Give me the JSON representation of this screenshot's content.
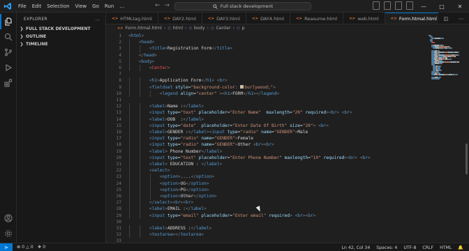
{
  "titlebar": {
    "menu": [
      "File",
      "Edit",
      "Selection",
      "View",
      "Go",
      "Run",
      "…"
    ],
    "search_text": "Full stack development",
    "window_controls": [
      "minimize",
      "maximize",
      "close"
    ]
  },
  "sidebar": {
    "header": "EXPLORER",
    "more": "…",
    "sections": [
      "FULL STACK DEVELOPMENT",
      "OUTLINE",
      "TIMELINE"
    ]
  },
  "tabs": [
    {
      "label": "HTMLtag.html",
      "active": false
    },
    {
      "label": "DAY2.html",
      "active": false
    },
    {
      "label": "DAY3.html",
      "active": false
    },
    {
      "label": "DAY4.html",
      "active": false
    },
    {
      "label": "Reasume.html",
      "active": false
    },
    {
      "label": "web.html",
      "active": false
    },
    {
      "label": "Form.htmal.html",
      "active": true
    },
    {
      "label": "demo.ht",
      "active": false
    }
  ],
  "tab_close": "×",
  "breadcrumb": [
    "Form.htmal.html",
    "html",
    "body",
    "Center",
    "p"
  ],
  "status": {
    "errors": "0",
    "warnings": "0",
    "ports": "0",
    "position": "Ln 42, Col 34",
    "spaces": "Spaces: 4",
    "encoding": "UTF-8",
    "eol": "CRLF",
    "language": "HTML"
  },
  "colors": {
    "accent": "#0078d4",
    "tag": "#569cd6",
    "attr": "#9cdcfe",
    "string": "#ce9178",
    "center_tag": "#f14c4c",
    "swatch": "#deb887"
  },
  "code_lines": [
    {
      "n": "1",
      "indent": 0,
      "tokens": [
        [
          "p",
          "<"
        ],
        [
          "t",
          "html"
        ],
        [
          "p",
          ">"
        ]
      ]
    },
    {
      "n": "2",
      "indent": 1,
      "tokens": [
        [
          "p",
          "<"
        ],
        [
          "t",
          "head"
        ],
        [
          "p",
          ">"
        ]
      ]
    },
    {
      "n": "3",
      "indent": 2,
      "tokens": [
        [
          "p",
          "<"
        ],
        [
          "t",
          "title"
        ],
        [
          "p",
          ">"
        ],
        [
          "tx",
          "Registration Form"
        ],
        [
          "p",
          "</"
        ],
        [
          "t",
          "title"
        ],
        [
          "p",
          ">"
        ]
      ]
    },
    {
      "n": "4",
      "indent": 1,
      "tokens": [
        [
          "p",
          "</"
        ],
        [
          "t",
          "head"
        ],
        [
          "p",
          ">"
        ]
      ]
    },
    {
      "n": "5",
      "indent": 1,
      "tokens": [
        [
          "p",
          "<"
        ],
        [
          "t",
          "body"
        ],
        [
          "p",
          ">"
        ]
      ]
    },
    {
      "n": "6",
      "indent": 2,
      "tokens": [
        [
          "p",
          "<"
        ],
        [
          "ctr",
          "Center"
        ],
        [
          "p",
          ">"
        ]
      ]
    },
    {
      "n": "7",
      "indent": 0,
      "tokens": []
    },
    {
      "n": "8",
      "indent": 2,
      "tokens": [
        [
          "p",
          "<"
        ],
        [
          "t",
          "h1"
        ],
        [
          "p",
          ">"
        ],
        [
          "tx",
          "Application Form"
        ],
        [
          "p",
          "</"
        ],
        [
          "t",
          "h1"
        ],
        [
          "p",
          ">"
        ],
        [
          "tx",
          " "
        ],
        [
          "p",
          "<"
        ],
        [
          "t",
          "br"
        ],
        [
          "p",
          ">"
        ]
      ]
    },
    {
      "n": "9",
      "indent": 2,
      "tokens": [
        [
          "p",
          "<"
        ],
        [
          "t",
          "fieldset"
        ],
        [
          "tx",
          " "
        ],
        [
          "a",
          "style"
        ],
        [
          "tx",
          "="
        ],
        [
          "s",
          "\"background-color: "
        ],
        [
          "sw",
          ""
        ],
        [
          "s",
          "burlywood;\""
        ],
        [
          "p",
          ">"
        ]
      ]
    },
    {
      "n": "10",
      "indent": 3,
      "tokens": [
        [
          "p",
          "<"
        ],
        [
          "t",
          "legend"
        ],
        [
          "tx",
          " "
        ],
        [
          "a",
          "align"
        ],
        [
          "tx",
          "="
        ],
        [
          "s",
          "\"center\""
        ],
        [
          "tx",
          " "
        ],
        [
          "p",
          ">"
        ],
        [
          "p",
          "<"
        ],
        [
          "t",
          "h1"
        ],
        [
          "p",
          ">"
        ],
        [
          "tx",
          "FORM"
        ],
        [
          "p",
          "</"
        ],
        [
          "t",
          "h1"
        ],
        [
          "p",
          ">"
        ],
        [
          "p",
          "</"
        ],
        [
          "t",
          "legend"
        ],
        [
          "p",
          ">"
        ]
      ]
    },
    {
      "n": "11",
      "indent": 0,
      "tokens": []
    },
    {
      "n": "12",
      "indent": 2,
      "tokens": [
        [
          "p",
          "<"
        ],
        [
          "t",
          "label"
        ],
        [
          "p",
          ">"
        ],
        [
          "tx",
          "Name :"
        ],
        [
          "p",
          "</"
        ],
        [
          "t",
          "label"
        ],
        [
          "p",
          ">"
        ]
      ]
    },
    {
      "n": "13",
      "indent": 2,
      "tokens": [
        [
          "p",
          "<"
        ],
        [
          "t",
          "input"
        ],
        [
          "tx",
          " "
        ],
        [
          "a",
          "type"
        ],
        [
          "tx",
          "="
        ],
        [
          "s",
          "\"text\""
        ],
        [
          "tx",
          " "
        ],
        [
          "a",
          "placeholder"
        ],
        [
          "tx",
          "="
        ],
        [
          "s",
          "\"Enter Name\""
        ],
        [
          "tx",
          "  "
        ],
        [
          "a",
          "maxlength"
        ],
        [
          "tx",
          "="
        ],
        [
          "s",
          "\"20\""
        ],
        [
          "tx",
          " "
        ],
        [
          "a",
          "required"
        ],
        [
          "p",
          ">"
        ],
        [
          "p",
          "<"
        ],
        [
          "t",
          "br"
        ],
        [
          "p",
          ">"
        ],
        [
          "tx",
          " "
        ],
        [
          "p",
          "<"
        ],
        [
          "t",
          "br"
        ],
        [
          "p",
          ">"
        ]
      ]
    },
    {
      "n": "14",
      "indent": 2,
      "tokens": [
        [
          "p",
          "<"
        ],
        [
          "t",
          "label"
        ],
        [
          "p",
          ">"
        ],
        [
          "tx",
          "DOB  :"
        ],
        [
          "p",
          "</"
        ],
        [
          "t",
          "label"
        ],
        [
          "p",
          ">"
        ]
      ]
    },
    {
      "n": "15",
      "indent": 2,
      "tokens": [
        [
          "p",
          "<"
        ],
        [
          "t",
          "input"
        ],
        [
          "tx",
          " "
        ],
        [
          "a",
          "type"
        ],
        [
          "tx",
          "="
        ],
        [
          "s",
          "\"date\""
        ],
        [
          "tx",
          "  "
        ],
        [
          "a",
          "placeholder"
        ],
        [
          "tx",
          "="
        ],
        [
          "s",
          "\"Enter Date Of Birth\""
        ],
        [
          "tx",
          " "
        ],
        [
          "a",
          "size"
        ],
        [
          "tx",
          "="
        ],
        [
          "s",
          "\"20\""
        ],
        [
          "p",
          ">"
        ],
        [
          "tx",
          " "
        ],
        [
          "p",
          "<"
        ],
        [
          "t",
          "br"
        ],
        [
          "p",
          ">"
        ]
      ]
    },
    {
      "n": "16",
      "indent": 2,
      "tokens": [
        [
          "p",
          "<"
        ],
        [
          "t",
          "label"
        ],
        [
          "p",
          ">"
        ],
        [
          "tx",
          "GENDER :"
        ],
        [
          "p",
          "</"
        ],
        [
          "t",
          "label"
        ],
        [
          "p",
          ">"
        ],
        [
          "p",
          "<"
        ],
        [
          "t",
          "input"
        ],
        [
          "tx",
          " "
        ],
        [
          "a",
          "type"
        ],
        [
          "tx",
          "="
        ],
        [
          "s",
          "\"radio\""
        ],
        [
          "tx",
          " "
        ],
        [
          "a",
          "name"
        ],
        [
          "tx",
          "="
        ],
        [
          "s",
          "\"GENDER\""
        ],
        [
          "p",
          ">"
        ],
        [
          "tx",
          "Male"
        ]
      ]
    },
    {
      "n": "17",
      "indent": 2,
      "tokens": [
        [
          "p",
          "<"
        ],
        [
          "t",
          "input"
        ],
        [
          "tx",
          " "
        ],
        [
          "a",
          "type"
        ],
        [
          "tx",
          "="
        ],
        [
          "s",
          "\"radio\""
        ],
        [
          "tx",
          " "
        ],
        [
          "a",
          "name"
        ],
        [
          "tx",
          "="
        ],
        [
          "s",
          "\"GENDER\""
        ],
        [
          "p",
          ">"
        ],
        [
          "tx",
          "Female"
        ]
      ]
    },
    {
      "n": "18",
      "indent": 2,
      "tokens": [
        [
          "p",
          "<"
        ],
        [
          "t",
          "input"
        ],
        [
          "tx",
          " "
        ],
        [
          "a",
          "type"
        ],
        [
          "tx",
          "="
        ],
        [
          "s",
          "\"radio\""
        ],
        [
          "tx",
          " "
        ],
        [
          "a",
          "name"
        ],
        [
          "tx",
          "="
        ],
        [
          "s",
          "\"GENDER\""
        ],
        [
          "p",
          ">"
        ],
        [
          "tx",
          "Other "
        ],
        [
          "p",
          "<"
        ],
        [
          "t",
          "br"
        ],
        [
          "p",
          ">"
        ],
        [
          "p",
          "<"
        ],
        [
          "t",
          "br"
        ],
        [
          "p",
          ">"
        ]
      ]
    },
    {
      "n": "19",
      "indent": 2,
      "tokens": [
        [
          "p",
          "<"
        ],
        [
          "t",
          "label"
        ],
        [
          "p",
          ">"
        ],
        [
          "tx",
          " Phone Number"
        ],
        [
          "p",
          "</"
        ],
        [
          "t",
          "label"
        ],
        [
          "p",
          ">"
        ]
      ]
    },
    {
      "n": "20",
      "indent": 2,
      "tokens": [
        [
          "p",
          "<"
        ],
        [
          "t",
          "input"
        ],
        [
          "tx",
          " "
        ],
        [
          "a",
          "type"
        ],
        [
          "tx",
          "="
        ],
        [
          "s",
          "\"text\""
        ],
        [
          "tx",
          " "
        ],
        [
          "a",
          "placeholder"
        ],
        [
          "tx",
          "="
        ],
        [
          "s",
          "\"Enter Phone Number\""
        ],
        [
          "tx",
          " "
        ],
        [
          "a",
          "maxlength"
        ],
        [
          "tx",
          "="
        ],
        [
          "s",
          "\"10\""
        ],
        [
          "tx",
          " "
        ],
        [
          "a",
          "required"
        ],
        [
          "p",
          ">"
        ],
        [
          "p",
          "<"
        ],
        [
          "t",
          "br"
        ],
        [
          "p",
          ">"
        ],
        [
          "tx",
          " "
        ],
        [
          "p",
          "<"
        ],
        [
          "t",
          "br"
        ],
        [
          "p",
          ">"
        ]
      ]
    },
    {
      "n": "21",
      "indent": 2,
      "tokens": [
        [
          "p",
          "<"
        ],
        [
          "t",
          "label"
        ],
        [
          "p",
          ">"
        ],
        [
          "tx",
          " EDUCATION : "
        ],
        [
          "p",
          "</"
        ],
        [
          "t",
          "label"
        ],
        [
          "p",
          ">"
        ]
      ]
    },
    {
      "n": "22",
      "indent": 2,
      "tokens": [
        [
          "p",
          "<"
        ],
        [
          "t",
          "select"
        ],
        [
          "p",
          ">"
        ]
      ]
    },
    {
      "n": "23",
      "indent": 3,
      "tokens": [
        [
          "p",
          "<"
        ],
        [
          "t",
          "option"
        ],
        [
          "p",
          ">"
        ],
        [
          "tx",
          "...."
        ],
        [
          "p",
          "</"
        ],
        [
          "t",
          "option"
        ],
        [
          "p",
          ">"
        ]
      ]
    },
    {
      "n": "24",
      "indent": 3,
      "tokens": [
        [
          "p",
          "<"
        ],
        [
          "t",
          "option"
        ],
        [
          "p",
          ">"
        ],
        [
          "tx",
          "UG"
        ],
        [
          "p",
          "</"
        ],
        [
          "t",
          "option"
        ],
        [
          "p",
          ">"
        ]
      ]
    },
    {
      "n": "25",
      "indent": 3,
      "tokens": [
        [
          "p",
          "<"
        ],
        [
          "t",
          "option"
        ],
        [
          "p",
          ">"
        ],
        [
          "tx",
          "PG"
        ],
        [
          "p",
          "</"
        ],
        [
          "t",
          "option"
        ],
        [
          "p",
          ">"
        ]
      ]
    },
    {
      "n": "26",
      "indent": 3,
      "tokens": [
        [
          "p",
          "<"
        ],
        [
          "t",
          "option"
        ],
        [
          "p",
          ">"
        ],
        [
          "tx",
          "Other"
        ],
        [
          "p",
          "</"
        ],
        [
          "t",
          "option"
        ],
        [
          "p",
          ">"
        ]
      ]
    },
    {
      "n": "27",
      "indent": 2,
      "tokens": [
        [
          "p",
          "</"
        ],
        [
          "t",
          "select"
        ],
        [
          "p",
          ">"
        ],
        [
          "p",
          "<"
        ],
        [
          "t",
          "br"
        ],
        [
          "p",
          ">"
        ],
        [
          "p",
          "<"
        ],
        [
          "t",
          "br"
        ],
        [
          "p",
          ">"
        ]
      ]
    },
    {
      "n": "28",
      "indent": 2,
      "tokens": [
        [
          "p",
          "<"
        ],
        [
          "t",
          "label"
        ],
        [
          "p",
          ">"
        ],
        [
          "tx",
          "EMAIL :"
        ],
        [
          "p",
          "</"
        ],
        [
          "t",
          "label"
        ],
        [
          "p",
          ">"
        ]
      ]
    },
    {
      "n": "29",
      "indent": 2,
      "tokens": [
        [
          "p",
          "<"
        ],
        [
          "t",
          "input"
        ],
        [
          "tx",
          " "
        ],
        [
          "a",
          "type"
        ],
        [
          "tx",
          "="
        ],
        [
          "s",
          "\"email\""
        ],
        [
          "tx",
          " "
        ],
        [
          "a",
          "placeholder"
        ],
        [
          "tx",
          "="
        ],
        [
          "s",
          "\"Enter email\""
        ],
        [
          "tx",
          " "
        ],
        [
          "a",
          "required"
        ],
        [
          "p",
          ">"
        ],
        [
          "tx",
          " "
        ],
        [
          "p",
          "<"
        ],
        [
          "t",
          "br"
        ],
        [
          "p",
          ">"
        ],
        [
          "p",
          "<"
        ],
        [
          "t",
          "br"
        ],
        [
          "p",
          ">"
        ]
      ]
    },
    {
      "n": "30",
      "indent": 0,
      "tokens": []
    },
    {
      "n": "31",
      "indent": 2,
      "tokens": [
        [
          "p",
          "<"
        ],
        [
          "t",
          "label"
        ],
        [
          "p",
          ">"
        ],
        [
          "tx",
          "ADDRESS :"
        ],
        [
          "p",
          "</"
        ],
        [
          "t",
          "label"
        ],
        [
          "p",
          ">"
        ]
      ]
    },
    {
      "n": "32",
      "indent": 2,
      "tokens": [
        [
          "p",
          "<"
        ],
        [
          "t",
          "textarea"
        ],
        [
          "p",
          ">"
        ],
        [
          "p",
          "</"
        ],
        [
          "t",
          "textarea"
        ],
        [
          "p",
          ">"
        ]
      ]
    },
    {
      "n": "33",
      "indent": 0,
      "tokens": []
    }
  ]
}
